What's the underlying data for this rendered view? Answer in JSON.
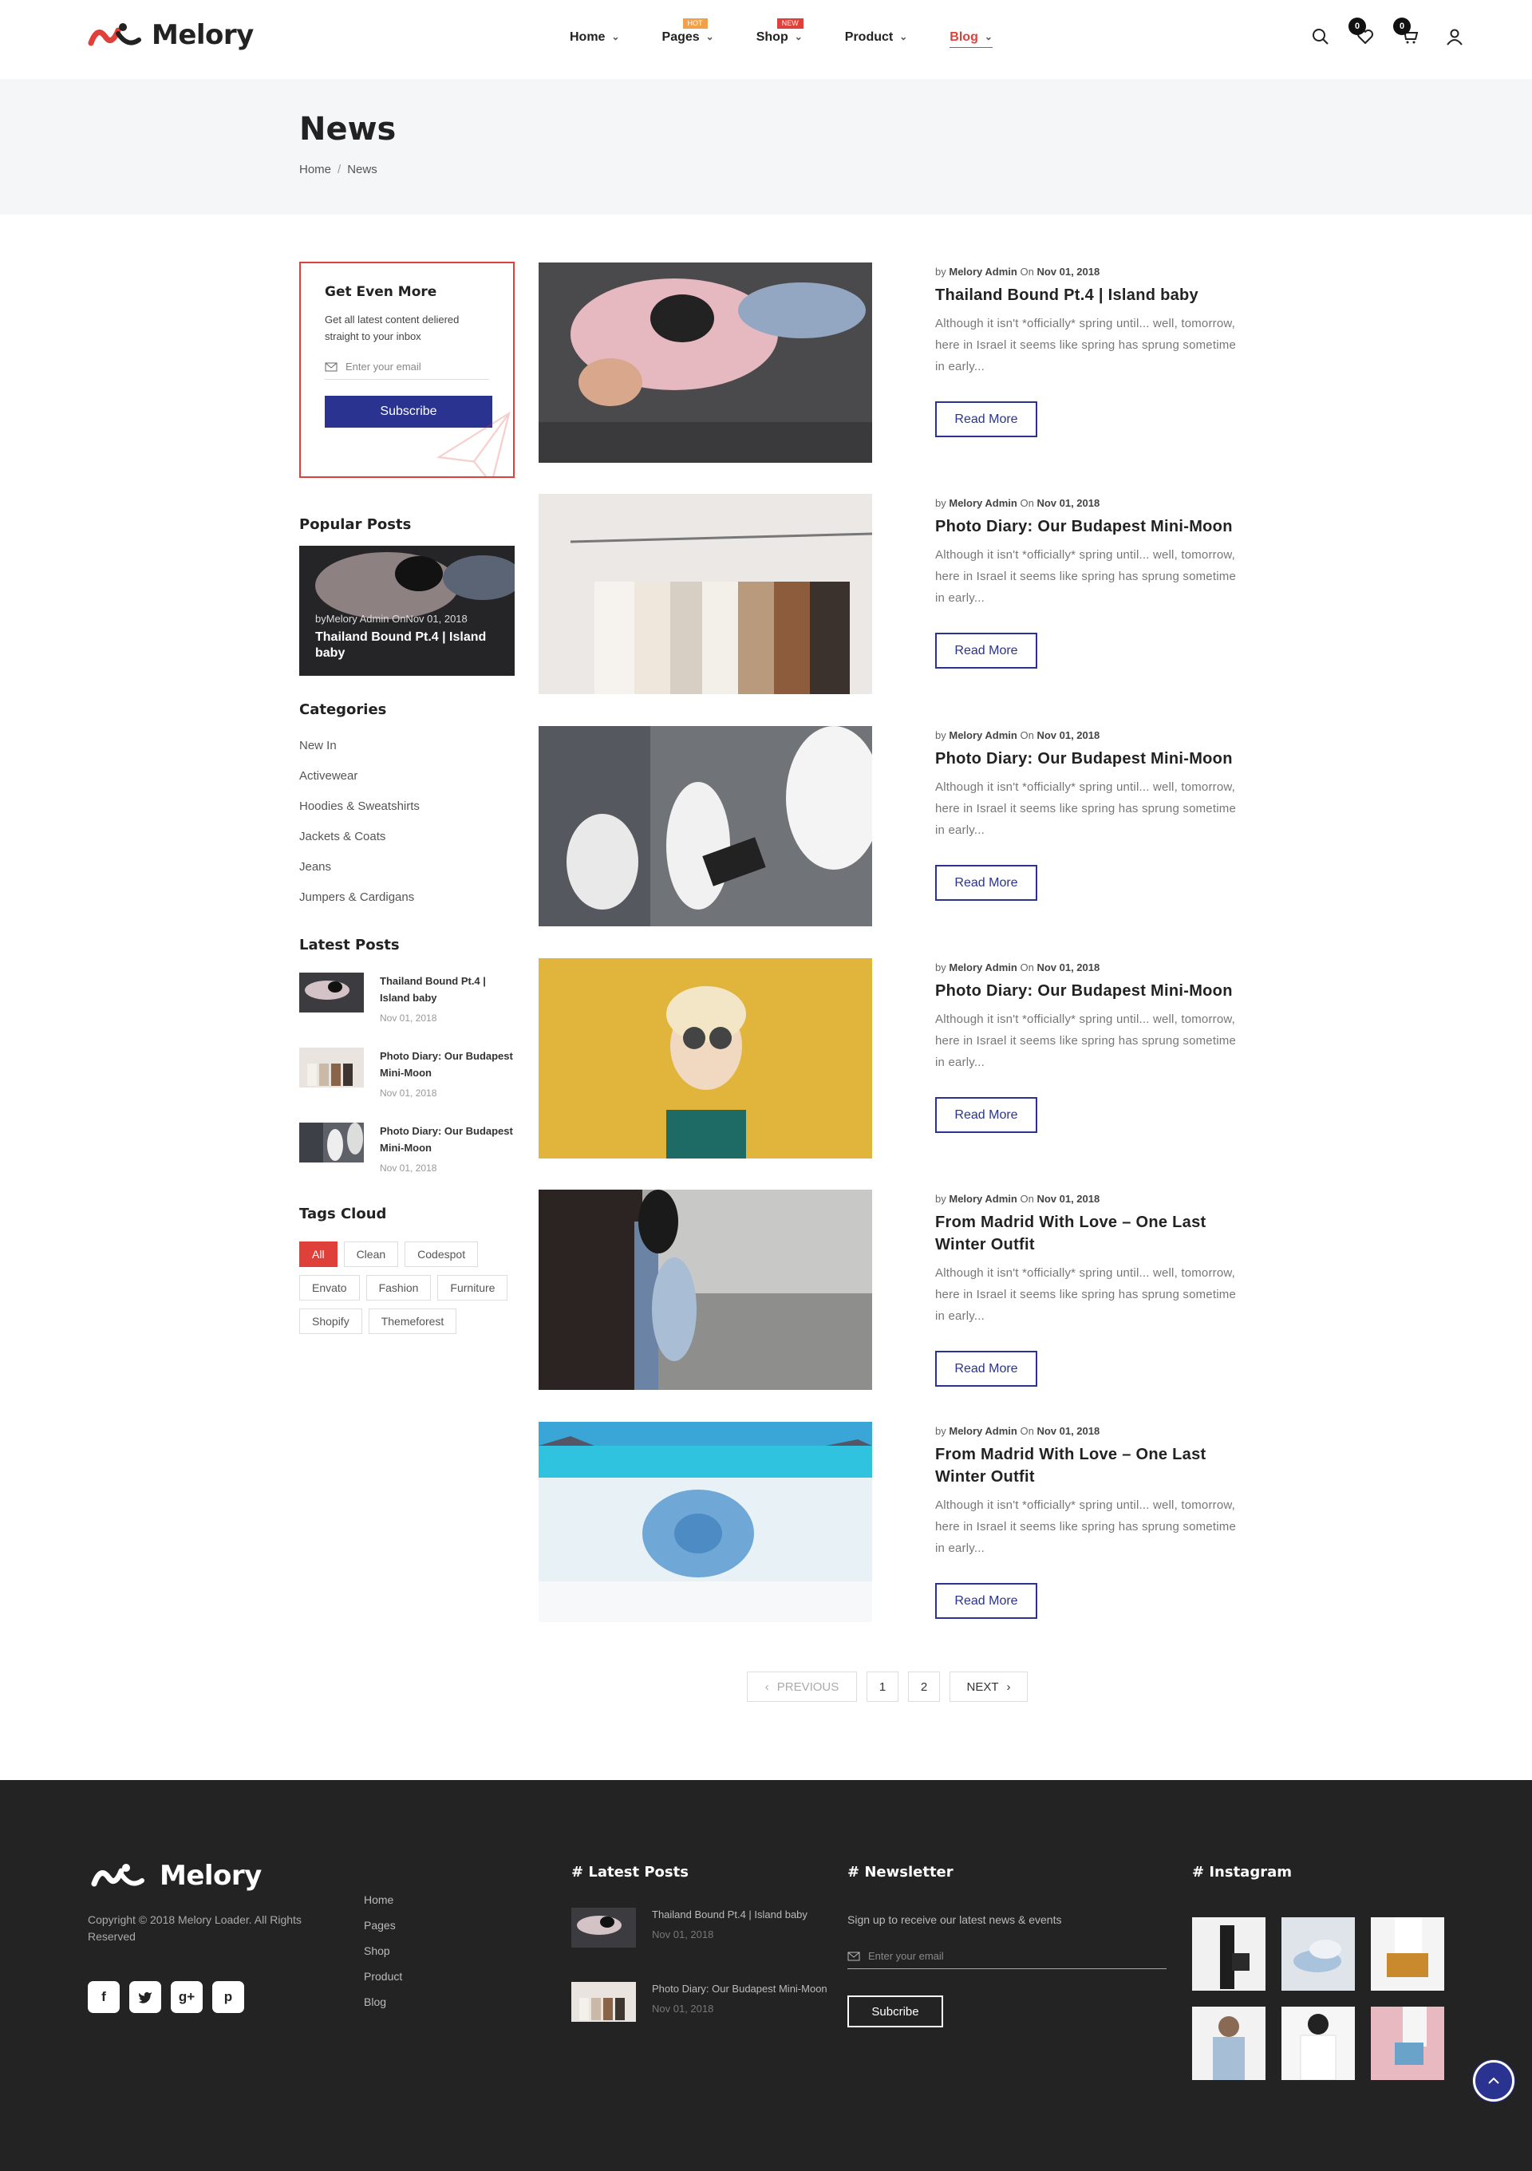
{
  "header": {
    "brand": "Melory",
    "nav": [
      {
        "label": "Home"
      },
      {
        "label": "Pages",
        "badge": "HOT"
      },
      {
        "label": "Shop",
        "badge": "NEW"
      },
      {
        "label": "Product"
      },
      {
        "label": "Blog"
      }
    ],
    "wishlist_count": "0",
    "cart_count": "0"
  },
  "page": {
    "title": "News",
    "breadcrumb": [
      "Home",
      "News"
    ],
    "breadcrumb_sep": "/"
  },
  "sidebar": {
    "subscribe": {
      "title": "Get Even More",
      "text": "Get all latest content deliered straight to your inbox",
      "placeholder": "Enter your email",
      "button": "Subscribe"
    },
    "popular_title": "Popular Posts",
    "popular": {
      "meta": "byMelory Admin OnNov 01, 2018",
      "title": "Thailand Bound Pt.4 | Island baby"
    },
    "categories_title": "Categories",
    "categories": [
      "New In",
      "Activewear",
      "Hoodies & Sweatshirts",
      "Jackets & Coats",
      "Jeans",
      "Jumpers & Cardigans"
    ],
    "latest_title": "Latest Posts",
    "latest": [
      {
        "title": "Thailand Bound Pt.4 | Island baby",
        "date": "Nov 01, 2018"
      },
      {
        "title": "Photo Diary: Our Budapest Mini-Moon",
        "date": "Nov 01, 2018"
      },
      {
        "title": "Photo Diary: Our Budapest Mini-Moon",
        "date": "Nov 01, 2018"
      }
    ],
    "tags_title": "Tags Cloud",
    "tags": [
      "All",
      "Clean",
      "Codespot",
      "Envato",
      "Fashion",
      "Furniture",
      "Shopify",
      "Themeforest"
    ]
  },
  "posts": [
    {
      "by": "by",
      "author": "Melory Admin",
      "on": "On",
      "date": "Nov 01, 2018",
      "title": "Thailand Bound Pt.4 | Island baby",
      "excerpt": "Although it isn't *officially* spring until... well, tomorrow, here in Israel it seems like spring has sprung sometime in early...",
      "button": "Read More"
    },
    {
      "by": "by",
      "author": "Melory Admin",
      "on": "On",
      "date": "Nov 01, 2018",
      "title": "Photo Diary: Our Budapest Mini-Moon",
      "excerpt": "Although it isn't *officially* spring until... well, tomorrow, here in Israel it seems like spring has sprung sometime in early...",
      "button": "Read More"
    },
    {
      "by": "by",
      "author": "Melory Admin",
      "on": "On",
      "date": "Nov 01, 2018",
      "title": "Photo Diary: Our Budapest Mini-Moon",
      "excerpt": "Although it isn't *officially* spring until... well, tomorrow, here in Israel it seems like spring has sprung sometime in early...",
      "button": "Read More"
    },
    {
      "by": "by",
      "author": "Melory Admin",
      "on": "On",
      "date": "Nov 01, 2018",
      "title": "Photo Diary: Our Budapest Mini-Moon",
      "excerpt": "Although it isn't *officially* spring until... well, tomorrow, here in Israel it seems like spring has sprung sometime in early...",
      "button": "Read More"
    },
    {
      "by": "by",
      "author": "Melory Admin",
      "on": "On",
      "date": "Nov 01, 2018",
      "title": "From Madrid With Love – One Last Winter Outfit",
      "excerpt": "Although it isn't *officially* spring until... well, tomorrow, here in Israel it seems like spring has sprung sometime in early...",
      "button": "Read More"
    },
    {
      "by": "by",
      "author": "Melory Admin",
      "on": "On",
      "date": "Nov 01, 2018",
      "title": "From Madrid With Love – One Last Winter Outfit",
      "excerpt": "Although it isn't *officially* spring until... well, tomorrow, here in Israel it seems like spring has sprung sometime in early...",
      "button": "Read More"
    }
  ],
  "pagination": {
    "prev": "PREVIOUS",
    "pages": [
      "1",
      "2"
    ],
    "next": "NEXT"
  },
  "footer": {
    "brand": "Melory",
    "copyright": "Copyright © 2018 Melory Loader. All Rights Reserved",
    "social": [
      "f",
      "t",
      "g+",
      "p"
    ],
    "links": [
      "Home",
      "Pages",
      "Shop",
      "Product",
      "Blog"
    ],
    "latest_title": "# Latest Posts",
    "latest": [
      {
        "title": "Thailand Bound Pt.4 | Island baby",
        "date": "Nov 01, 2018"
      },
      {
        "title": "Photo Diary: Our Budapest Mini-Moon",
        "date": "Nov 01, 2018"
      }
    ],
    "newsletter_title": "# Newsletter",
    "newsletter_text": "Sign up to receive our latest news & events",
    "newsletter_placeholder": "Enter your email",
    "newsletter_button": "Subcribe",
    "instagram_title": "# Instagram"
  },
  "colors": {
    "accent": "#e0403a",
    "primary": "#2a3390",
    "footer_bg": "#232323"
  }
}
